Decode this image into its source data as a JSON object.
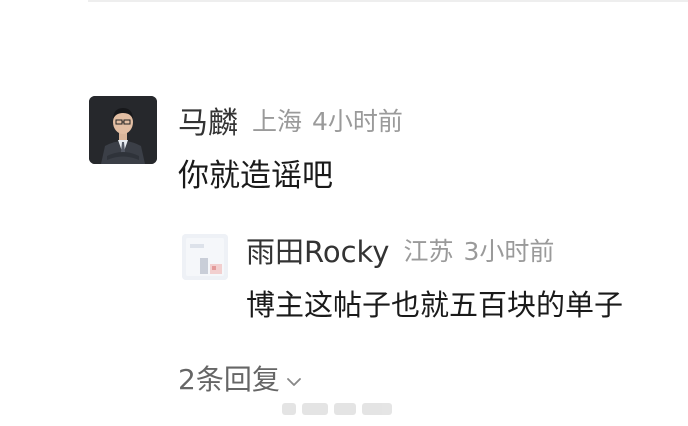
{
  "comment": {
    "author": "马麟",
    "location": "上海",
    "time": "4小时前",
    "text": "你就造谣吧",
    "avatar_icon": "person-in-suit-photo"
  },
  "reply": {
    "author": "雨田Rocky",
    "location": "江苏",
    "time": "3小时前",
    "text": "博主这帖子也就五百块的单子",
    "avatar_icon": "image-placeholder"
  },
  "more_replies": {
    "label": "2条回复",
    "icon": "chevron-down-icon"
  },
  "colors": {
    "name": "#333333",
    "meta": "#9a9a9a",
    "text": "#1a1a1a",
    "link": "#666666"
  }
}
